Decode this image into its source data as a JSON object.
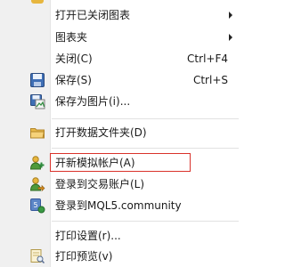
{
  "menu": {
    "items": [
      {
        "label": "打开已关闭图表",
        "has_submenu": true
      },
      {
        "label": "图表夹",
        "has_submenu": true
      },
      {
        "label": "关闭(C)",
        "shortcut": "Ctrl+F4"
      },
      {
        "label": "保存(S)",
        "shortcut": "Ctrl+S",
        "icon": "save-icon"
      },
      {
        "label": "保存为图片(i)...",
        "icon": "save-as-picture-icon"
      },
      {
        "label": "打开数据文件夹(D)",
        "icon": "folder-icon"
      },
      {
        "label": "开新模拟帐户(A)",
        "icon": "new-demo-account-icon",
        "highlighted": true
      },
      {
        "label": "登录到交易账户(L)",
        "icon": "login-account-icon"
      },
      {
        "label": "登录到MQL5.community",
        "icon": "mql5-icon"
      },
      {
        "label": "打印设置(r)..."
      },
      {
        "label": "打印预览(v)",
        "icon": "print-preview-icon"
      }
    ]
  },
  "colors": {
    "highlight_border": "#d9322b",
    "gutter": "#f0f0f0"
  }
}
